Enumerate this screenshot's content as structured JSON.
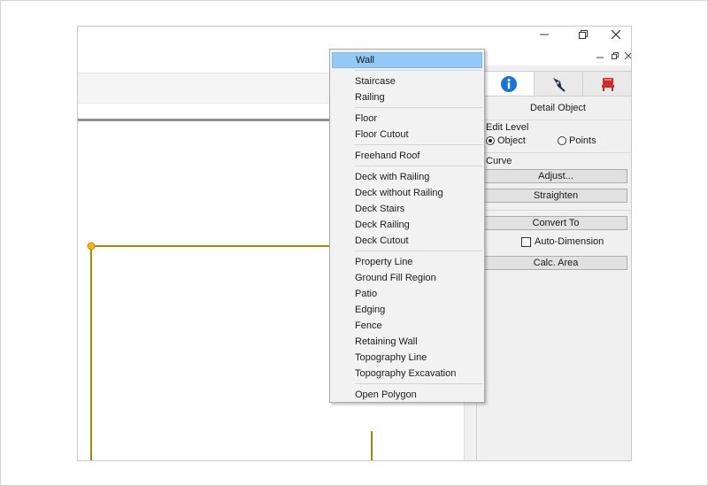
{
  "context_menu": {
    "groups": [
      [
        "Wall"
      ],
      [
        "Staircase",
        "Railing"
      ],
      [
        "Floor",
        "Floor Cutout"
      ],
      [
        "Freehand Roof"
      ],
      [
        "Deck with Railing",
        "Deck without Railing",
        "Deck Stairs",
        "Deck Railing",
        "Deck Cutout"
      ],
      [
        "Property Line",
        "Ground Fill Region",
        "Patio",
        "Edging",
        "Fence",
        "Retaining Wall",
        "Topography Line",
        "Topography Excavation"
      ],
      [
        "Open Polygon"
      ]
    ],
    "highlighted": "Wall"
  },
  "panel": {
    "tabs": [
      {
        "icon": "info-icon",
        "color": "#1a73d9"
      },
      {
        "icon": "pen-nib-icon",
        "color": "#1f2d40"
      },
      {
        "icon": "chair-icon",
        "color": "#d42a2a"
      }
    ],
    "title": "Detail Object",
    "edit_level_label": "Edit Level",
    "object_label": "Object",
    "points_label": "Points",
    "curve_label": "Curve",
    "adjust_label": "Adjust...",
    "straighten_label": "Straighten",
    "convert_to_label": "Convert To",
    "auto_dimension_label": "Auto-Dimension",
    "calc_area_label": "Calc. Area",
    "selected_edit_level": "Object"
  },
  "canvas": {
    "outline_color": "#a08c00",
    "handle_color": "#f2b31a"
  }
}
